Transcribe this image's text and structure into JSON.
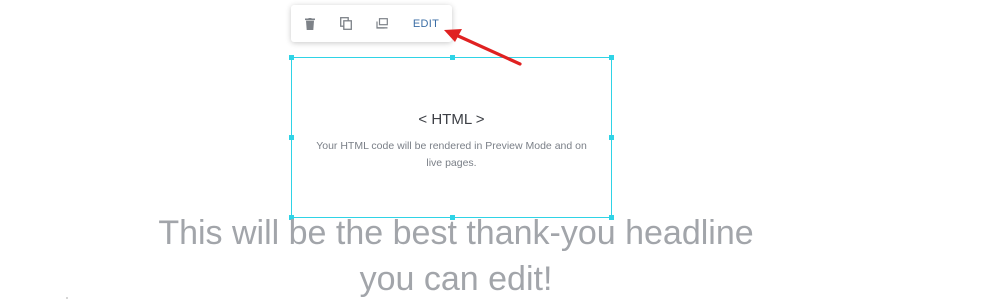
{
  "toolbar": {
    "delete_icon": "trash-icon",
    "duplicate_icon": "duplicate-icon",
    "copy_icon": "copy-icon",
    "edit_label": "EDIT",
    "edit_color": "#3b6ea5"
  },
  "widget": {
    "title": "< HTML >",
    "description": "Your HTML code will be rendered in Preview Mode and on live pages.",
    "frame_color": "#2fd3e6"
  },
  "headline": {
    "text": "This will be the best thank-you headline you can edit!"
  },
  "annotation": {
    "arrow_color": "#e02121"
  }
}
